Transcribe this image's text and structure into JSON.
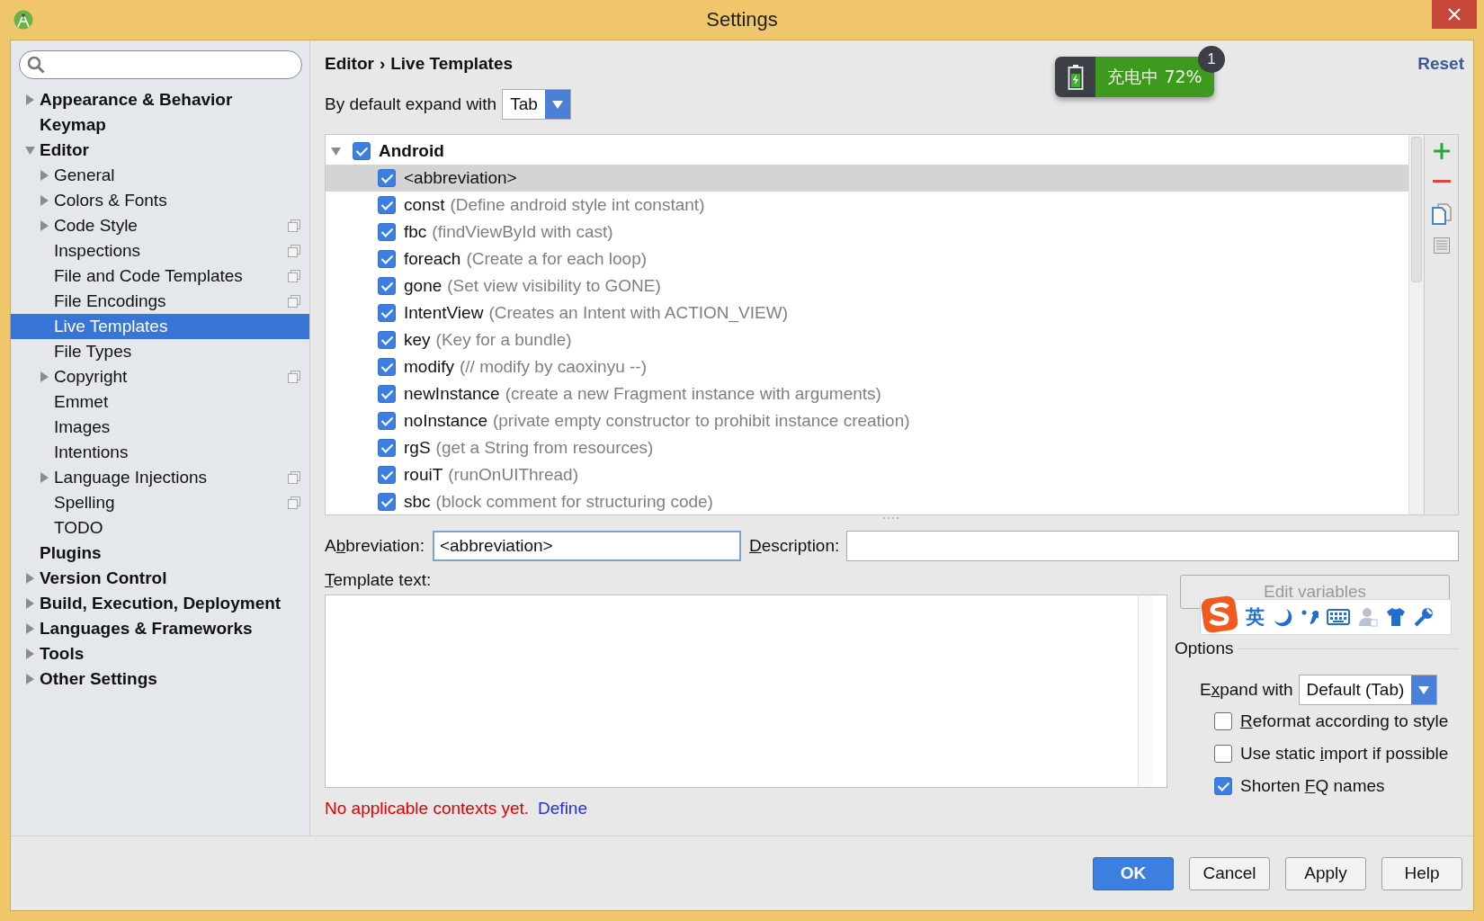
{
  "window": {
    "title": "Settings"
  },
  "sidebar": {
    "items": [
      {
        "label": "Appearance & Behavior",
        "expanded": false,
        "selected": false,
        "copy_icon": false
      },
      {
        "label": "Keymap",
        "selected": false,
        "copy_icon": false
      },
      {
        "label": "Editor",
        "expanded": true,
        "selected": false,
        "copy_icon": false,
        "children": [
          {
            "label": "General",
            "expanded": false,
            "selected": false,
            "copy_icon": false
          },
          {
            "label": "Colors & Fonts",
            "expanded": false,
            "selected": false,
            "copy_icon": false
          },
          {
            "label": "Code Style",
            "expanded": false,
            "selected": false,
            "copy_icon": true
          },
          {
            "label": "Inspections",
            "selected": false,
            "copy_icon": true
          },
          {
            "label": "File and Code Templates",
            "selected": false,
            "copy_icon": true
          },
          {
            "label": "File Encodings",
            "selected": false,
            "copy_icon": true
          },
          {
            "label": "Live Templates",
            "selected": true,
            "copy_icon": false
          },
          {
            "label": "File Types",
            "selected": false,
            "copy_icon": false
          },
          {
            "label": "Copyright",
            "expanded": false,
            "selected": false,
            "copy_icon": true
          },
          {
            "label": "Emmet",
            "selected": false,
            "copy_icon": false
          },
          {
            "label": "Images",
            "selected": false,
            "copy_icon": false
          },
          {
            "label": "Intentions",
            "selected": false,
            "copy_icon": false
          },
          {
            "label": "Language Injections",
            "expanded": false,
            "selected": false,
            "copy_icon": true
          },
          {
            "label": "Spelling",
            "selected": false,
            "copy_icon": true
          },
          {
            "label": "TODO",
            "selected": false,
            "copy_icon": false
          }
        ]
      },
      {
        "label": "Plugins",
        "selected": false,
        "copy_icon": false
      },
      {
        "label": "Version Control",
        "expanded": false,
        "selected": false,
        "copy_icon": false
      },
      {
        "label": "Build, Execution, Deployment",
        "expanded": false,
        "selected": false,
        "copy_icon": false
      },
      {
        "label": "Languages & Frameworks",
        "expanded": false,
        "selected": false,
        "copy_icon": false
      },
      {
        "label": "Tools",
        "expanded": false,
        "selected": false,
        "copy_icon": false
      },
      {
        "label": "Other Settings",
        "expanded": false,
        "selected": false,
        "copy_icon": false
      }
    ]
  },
  "breadcrumb": {
    "items": [
      "Editor",
      "Live Templates"
    ],
    "separator": "›"
  },
  "reset_link": "Reset",
  "battery_notification": {
    "text": "充电中 72%",
    "count": "1"
  },
  "expand_default": {
    "label": "By default expand with",
    "value": "Tab"
  },
  "templates": {
    "groups": [
      {
        "name": "Android",
        "expanded": true,
        "checked": true,
        "items": [
          {
            "abbreviation": "<abbreviation>",
            "checked": true,
            "selected": true
          },
          {
            "abbreviation": "const",
            "description": "(Define android style int constant)",
            "checked": true,
            "selected": false
          },
          {
            "abbreviation": "fbc",
            "description": "(findViewById with cast)",
            "checked": true,
            "selected": false
          },
          {
            "abbreviation": "foreach",
            "description": "(Create a for each loop)",
            "checked": true,
            "selected": false
          },
          {
            "abbreviation": "gone",
            "description": "(Set view visibility to GONE)",
            "checked": true,
            "selected": false
          },
          {
            "abbreviation": "IntentView",
            "description": "(Creates an Intent with ACTION_VIEW)",
            "checked": true,
            "selected": false
          },
          {
            "abbreviation": "key",
            "description": "(Key for a bundle)",
            "checked": true,
            "selected": false
          },
          {
            "abbreviation": "modify",
            "description": "(//  modify by caoxinyu  --)",
            "checked": true,
            "selected": false
          },
          {
            "abbreviation": "newInstance",
            "description": "(create a new Fragment instance with arguments)",
            "checked": true,
            "selected": false
          },
          {
            "abbreviation": "noInstance",
            "description": "(private empty constructor to prohibit instance creation)",
            "checked": true,
            "selected": false
          },
          {
            "abbreviation": "rgS",
            "description": "(get a String from resources)",
            "checked": true,
            "selected": false
          },
          {
            "abbreviation": "rouiT",
            "description": "(runOnUIThread)",
            "checked": true,
            "selected": false
          },
          {
            "abbreviation": "sbc",
            "description": "(block comment for structuring code)",
            "checked": true,
            "selected": false
          }
        ]
      }
    ]
  },
  "abbreviation": {
    "label": {
      "pre": "A",
      "key": "b",
      "post": "breviation:"
    },
    "value": "<abbreviation>"
  },
  "description": {
    "label": {
      "key": "D",
      "post": "escription:"
    }
  },
  "template_text": {
    "label": {
      "key": "T",
      "post": "emplate text:"
    }
  },
  "edit_variables_button": {
    "label": "Edit variables",
    "disabled": true
  },
  "ime_toolbar": {
    "language": "英"
  },
  "options": {
    "title": "Options",
    "expand_with": {
      "label": {
        "pre": "E",
        "key": "x",
        "post": "pand with"
      },
      "value": "Default (Tab)"
    },
    "checkboxes": [
      {
        "label": {
          "key": "R",
          "post": "eformat according to style"
        },
        "checked": false
      },
      {
        "label": {
          "pre": "Use static ",
          "key": "i",
          "post": "mport if possible"
        },
        "checked": false
      },
      {
        "label": {
          "pre": "Shorten ",
          "key": "F",
          "post": "Q names"
        },
        "checked": true
      }
    ]
  },
  "contexts": {
    "message": "No applicable contexts yet.",
    "link": "Define"
  },
  "buttons": [
    {
      "label": "OK",
      "default": true
    },
    {
      "label": "Cancel",
      "default": false
    },
    {
      "label": "Apply",
      "default": false
    },
    {
      "label": "Help",
      "default": false
    }
  ]
}
